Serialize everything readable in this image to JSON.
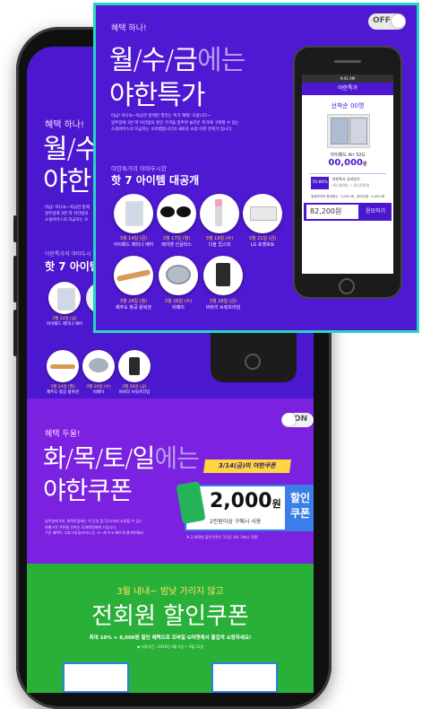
{
  "panel": {
    "toggle_label": "OFF",
    "tag": "혜택 하나!",
    "title_line1_part1": "월/수/금",
    "title_line1_part2": "에는",
    "title_line2": "야한특가",
    "desc": [
      "야금! 야나쇼~야금한 밤에만 열리는 특가 혜택! 오랍니다~",
      "일주일에 3번 딱 야간밤의 할인 가격을 맞추면 놀라운 특가에 구매할 수 있는",
      "소셜커머스의 지금하는 오버랩됩니다의 새로운 쇼핑 야한 분위기 입니다."
    ],
    "sub_heading": "야한특가의 야마두시한",
    "heading": "핫 7 아이템 대공개",
    "items": [
      {
        "date": "3월 14일 (금)",
        "name": "아이패드 레티나 에어",
        "icon": "tablet-icon"
      },
      {
        "date": "3월 17일 (월)",
        "name": "레이밴 선글라스",
        "icon": "sunglasses-icon"
      },
      {
        "date": "3월 19일 (수)",
        "name": "디올 립스틱",
        "icon": "lipstick-icon"
      },
      {
        "date": "3월 21일 (금)",
        "name": "LG 포켓포토",
        "icon": "printer-icon"
      },
      {
        "date": "3월 24일 (월)",
        "name": "제주도 항공 왕복권",
        "icon": "airplane-icon"
      },
      {
        "date": "3월 26일 (수)",
        "name": "비페이",
        "icon": "disc-icon"
      },
      {
        "date": "3월 28일 (금)",
        "name": "바바리 브릿프라임",
        "icon": "perfume-icon"
      }
    ],
    "mini": {
      "time": "9:41 AM",
      "app_title": "야한특가",
      "first_label": "선착순 00명",
      "product_name": "아이패드 Air 32G",
      "price": "00,000",
      "price_unit": "원",
      "discount": "70-80",
      "discount_unit": "%",
      "meta1": "야한특가 공지받기",
      "meta2": "00,000원 → 00,000원",
      "stats": "현재까지의 응모횟수 : 0,000 회 , 참여수량 : 0,000 회",
      "entry_price": "82,200원",
      "apply_button": "응모하기"
    }
  },
  "phone": {
    "tag": "혜택 하나!",
    "title_part1": "월/수",
    "title_part2": "야한",
    "desc": [
      "야금! 야나쇼~야금한 밤에",
      "일주일에 3번 딱 야간밤의",
      "소셜커머스의 지금하는 오"
    ],
    "sub_heading": "야한특가의 야마두시",
    "heading": "핫 7 아이템",
    "items_row1": [
      {
        "date": "3월 14일 (금)",
        "name": "아이패드 레티나 에어"
      }
    ],
    "items_row2": [
      {
        "date": "3월 24일 (월)",
        "name": "제주도 항공 왕복권"
      },
      {
        "date": "3월 26일 (수)",
        "name": "비페이"
      },
      {
        "date": "3월 28일 (금)",
        "name": "바바리 브릿프라임"
      }
    ]
  },
  "section2": {
    "tag": "혜택 두울!",
    "toggle_label": "ON",
    "title_part1": "화/목/토/일",
    "title_part2": "에는",
    "title_line2": "야한쿠폰",
    "badge": "3/14(금)의 야한쿠폰",
    "desc": [
      "일주일에 4번, 화목토일에는 딱 당일 밤 12시까지 사용할 수 있는",
      "특별가격 쿠폰을 선착순 3,000명에게 드립니다.",
      "구운 혜택이 그대그대 달라지니 눈 크~게 뜨고 빠르게 챙겨야해요!"
    ],
    "coupon_amount": "2,000",
    "coupon_unit": "원",
    "coupon_sub": "2만원이상 구매시 사용",
    "coupon_side": "할인 쿠폰",
    "coupon_note": "※ 2,000원 할인쿠폰이 1인당 1회 구매시 적용!"
  },
  "section3": {
    "sub": "3월 내내~ 밤낮 가리지 않고",
    "title": "전회원 할인쿠폰",
    "desc": "최대 10% + 8,000원 할인 혜택으로 모바일 G마켓에서 즐겁게 쇼핑하세요!",
    "note": "◆ 사용기간 : 2014년 3월 1일 ~ 3월 31일"
  },
  "colors": {
    "purple": "#4c18cf",
    "violet": "#7b21e0",
    "green": "#29b038",
    "teal_border": "#23d6c6",
    "yellow": "#ffd640",
    "accent_blue": "#3b2fe0"
  }
}
